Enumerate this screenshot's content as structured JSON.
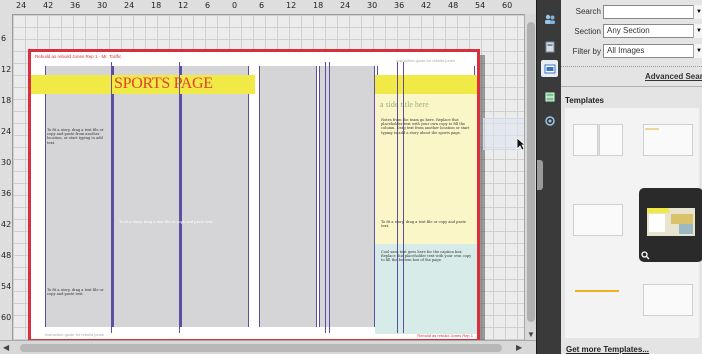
{
  "ruler": {
    "top_numbers": [
      "24",
      "42",
      "36",
      "30",
      "24",
      "18",
      "12",
      "6",
      "0",
      "6",
      "12",
      "18",
      "24",
      "30",
      "36",
      "42",
      "48",
      "54",
      "60"
    ],
    "left_numbers": [
      "6",
      "12",
      "18",
      "24",
      "30",
      "36",
      "42",
      "48",
      "54",
      "60"
    ]
  },
  "spread": {
    "folio_top_left": "Rebuild as rebuild Jones Rep 1 · Mr. Traffic",
    "folio_top_right": "Instruction guide for rebuild jones",
    "folio_bottom_left": "Instruction guide for rebuild jones",
    "folio_bottom_right": "Rebuild as rebuild Jones Rep 1",
    "title": "SPORTS PAGE",
    "story_head": "a side title here",
    "body_left_1": "To fit a story, drag a text file or copy and paste from another location; or start typing to add text.",
    "body_left_2": "To fit a story, drag a text file or copy and paste text.",
    "body_mid": "To fit a story, drag a text file or copy and paste text.",
    "body_right_1": "Notes from the team go here. Replace this placeholder text with your own copy to fill the column. Drag text from another location or start typing to add a story about the sports page.",
    "body_right_2": "To fit a story, drag a text file or copy and paste text.",
    "body_right_3": "Cool sans text goes here for the caption box. Replace this placeholder text with your own copy to fill the bottom box of the page."
  },
  "panel": {
    "search_label": "Search",
    "search_value": "",
    "section_label": "Section",
    "section_value": "Any Section",
    "filter_label": "Filter by",
    "filter_value": "All Images",
    "advanced_search": "Advanced Search",
    "templates_heading": "Templates",
    "get_more": "Get more Templates..."
  },
  "colors": {
    "accent_red": "#d8303f",
    "banner_yellow": "#f1ea46",
    "guide_purple": "#5a4fa0"
  },
  "icons": [
    "people-icon",
    "page-icon",
    "image-icon",
    "box-icon",
    "compass-icon",
    "magnifier-icon"
  ]
}
